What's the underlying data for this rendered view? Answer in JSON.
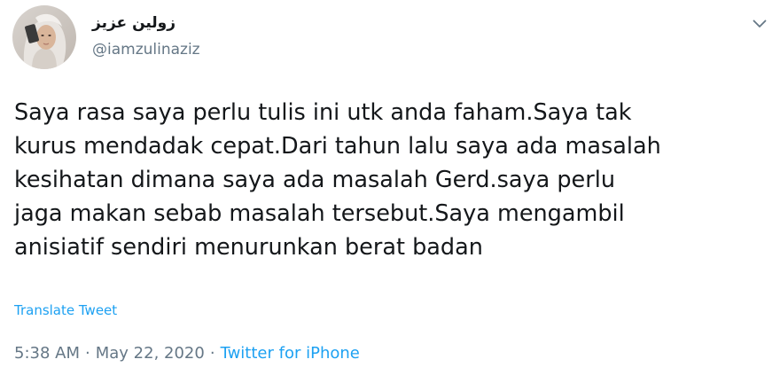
{
  "user": {
    "display_name": "زولين عزيز",
    "handle": "@iamzulinaziz",
    "avatar_icon": "profile-photo"
  },
  "tweet": {
    "lines": [
      "Saya rasa saya perlu tulis ini utk anda faham.Saya tak",
      "kurus mendadak cepat.Dari tahun lalu saya ada masalah",
      "kesihatan dimana saya ada masalah Gerd.saya perlu",
      "jaga makan sebab masalah tersebut.Saya mengambil",
      "anisiatif sendiri menurunkan berat badan"
    ],
    "translate_label": "Translate Tweet",
    "time": "5:38 AM",
    "separator": "·",
    "date": "May 22, 2020",
    "source": "Twitter for iPhone"
  },
  "menu": {
    "icon": "chevron-down-icon"
  },
  "colors": {
    "text": "#14171a",
    "secondary": "#657786",
    "link": "#1da1f2"
  }
}
